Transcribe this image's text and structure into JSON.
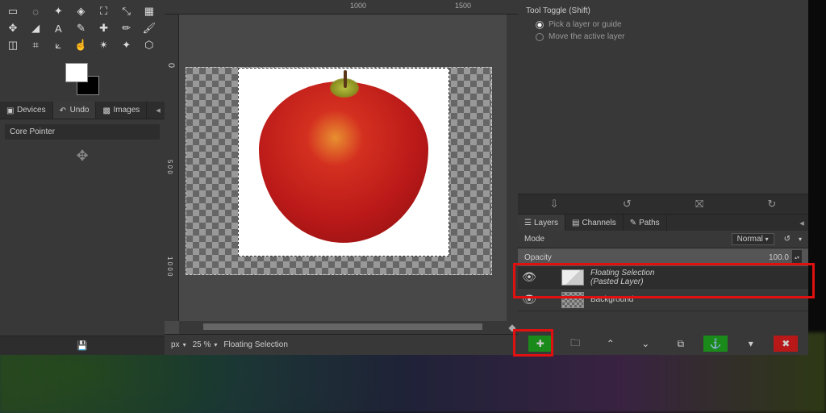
{
  "left_panel": {
    "tabs": {
      "devices": "Devices",
      "undo": "Undo",
      "images": "Images"
    },
    "core_pointer": "Core Pointer"
  },
  "ruler": {
    "m1000": "1000",
    "m1500": "1500",
    "v0": "0",
    "v500": "5\n0\n0",
    "v1000": "1\n0\n0\n0"
  },
  "statusbar": {
    "unit": "px",
    "zoom": "25 %",
    "status": "Floating Selection"
  },
  "tool_options": {
    "title": "Tool Toggle  (Shift)",
    "opt1": "Pick a layer or guide",
    "opt2": "Move the active layer"
  },
  "layers_panel": {
    "tabs": {
      "layers": "Layers",
      "channels": "Channels",
      "paths": "Paths"
    },
    "mode_label": "Mode",
    "mode_value": "Normal",
    "opacity_label": "Opacity",
    "opacity_value": "100.0",
    "layers": {
      "floating1": "Floating Selection",
      "floating2": "(Pasted Layer)",
      "background": "Background"
    }
  }
}
